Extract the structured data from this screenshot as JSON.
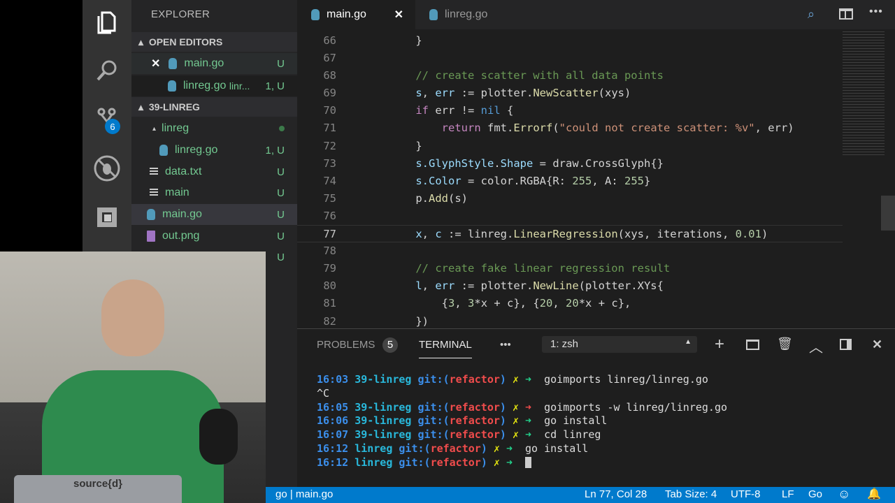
{
  "activity_bar": {
    "scm_badge": "6"
  },
  "sidebar": {
    "title": "EXPLORER",
    "open_editors": {
      "header": "OPEN EDITORS",
      "items": [
        {
          "name": "main.go",
          "status": "U"
        },
        {
          "name": "linreg.go",
          "desc": "linr...",
          "status": "1, U"
        }
      ]
    },
    "project": {
      "header": "39-LINREG",
      "items": [
        {
          "name": "linreg",
          "type": "folder"
        },
        {
          "name": "linreg.go",
          "status": "1, U"
        },
        {
          "name": "data.txt",
          "status": "U"
        },
        {
          "name": "main",
          "status": "U"
        },
        {
          "name": "main.go",
          "status": "U"
        },
        {
          "name": "out.png",
          "status": "U"
        },
        {
          "name": "",
          "status": "U"
        }
      ]
    }
  },
  "tabs": [
    {
      "label": "main.go",
      "active": true
    },
    {
      "label": "linreg.go",
      "active": false
    }
  ],
  "code": [
    {
      "n": "66",
      "t": [
        [
          "    }",
          "p"
        ]
      ]
    },
    {
      "n": "67",
      "t": []
    },
    {
      "n": "68",
      "t": [
        [
          "    // create scatter with all data points",
          "c"
        ]
      ]
    },
    {
      "n": "69",
      "t": [
        [
          "    s",
          "v"
        ],
        [
          ", ",
          "p"
        ],
        [
          "err",
          "v"
        ],
        [
          " := plotter.",
          "p"
        ],
        [
          "NewScatter",
          "f"
        ],
        [
          "(xys)",
          "p"
        ]
      ]
    },
    {
      "n": "70",
      "t": [
        [
          "    if",
          "k"
        ],
        [
          " err != ",
          "p"
        ],
        [
          "nil",
          "b"
        ],
        [
          " {",
          "p"
        ]
      ]
    },
    {
      "n": "71",
      "t": [
        [
          "        return",
          "k"
        ],
        [
          " fmt.",
          "p"
        ],
        [
          "Errorf",
          "f"
        ],
        [
          "(",
          "p"
        ],
        [
          "\"could not create scatter: %v\"",
          "s"
        ],
        [
          ", err)",
          "p"
        ]
      ]
    },
    {
      "n": "72",
      "t": [
        [
          "    }",
          "p"
        ]
      ]
    },
    {
      "n": "73",
      "t": [
        [
          "    s.",
          "v"
        ],
        [
          "GlyphStyle",
          "v"
        ],
        [
          ".",
          "p"
        ],
        [
          "Shape",
          "v"
        ],
        [
          " = draw.",
          "p"
        ],
        [
          "CrossGlyph",
          "p"
        ],
        [
          "{}",
          "p"
        ]
      ]
    },
    {
      "n": "74",
      "t": [
        [
          "    s.",
          "v"
        ],
        [
          "Color",
          "v"
        ],
        [
          " = color.",
          "p"
        ],
        [
          "RGBA",
          "p"
        ],
        [
          "{R: ",
          "p"
        ],
        [
          "255",
          "n"
        ],
        [
          ", A: ",
          "p"
        ],
        [
          "255",
          "n"
        ],
        [
          "}",
          "p"
        ]
      ]
    },
    {
      "n": "75",
      "t": [
        [
          "    p.",
          "p"
        ],
        [
          "Add",
          "f"
        ],
        [
          "(s)",
          "p"
        ]
      ]
    },
    {
      "n": "76",
      "t": []
    },
    {
      "n": "77",
      "t": [
        [
          "    x",
          "v"
        ],
        [
          ", ",
          "p"
        ],
        [
          "c",
          "v"
        ],
        [
          " := linreg.",
          "p"
        ],
        [
          "LinearRegression",
          "f"
        ],
        [
          "(xys, iterations, ",
          "p"
        ],
        [
          "0.01",
          "n"
        ],
        [
          ")",
          "p"
        ]
      ],
      "current": true
    },
    {
      "n": "78",
      "t": []
    },
    {
      "n": "79",
      "t": [
        [
          "    // create fake linear regression result",
          "c"
        ]
      ]
    },
    {
      "n": "80",
      "t": [
        [
          "    l",
          "v"
        ],
        [
          ", ",
          "p"
        ],
        [
          "err",
          "v"
        ],
        [
          " := plotter.",
          "p"
        ],
        [
          "NewLine",
          "f"
        ],
        [
          "(plotter.XYs{",
          "p"
        ]
      ]
    },
    {
      "n": "81",
      "t": [
        [
          "        {",
          "p"
        ],
        [
          "3",
          "n"
        ],
        [
          ", ",
          "p"
        ],
        [
          "3",
          "n"
        ],
        [
          "*x + c}, {",
          "p"
        ],
        [
          "20",
          "n"
        ],
        [
          ", ",
          "p"
        ],
        [
          "20",
          "n"
        ],
        [
          "*x + c},",
          "p"
        ]
      ]
    },
    {
      "n": "82",
      "t": [
        [
          "    })",
          "p"
        ]
      ]
    }
  ],
  "panel": {
    "problems_label": "PROBLEMS",
    "problems_count": "5",
    "terminal_label": "TERMINAL",
    "more": "•••",
    "shell_select": "1: zsh"
  },
  "terminal": [
    [
      [
        "16:03 ",
        "tm"
      ],
      [
        "39-linreg ",
        "dir"
      ],
      [
        "git:(",
        "gb"
      ],
      [
        "refactor",
        "gr"
      ],
      [
        ") ",
        "gb"
      ],
      [
        "✗ ",
        "y"
      ],
      [
        "➜ ",
        "g"
      ],
      [
        " goimports linreg/linreg.go",
        ""
      ]
    ],
    [
      [
        "^C",
        ""
      ]
    ],
    [
      [
        "16:05 ",
        "tm"
      ],
      [
        "39-linreg ",
        "dir"
      ],
      [
        "git:(",
        "gb"
      ],
      [
        "refactor",
        "gr"
      ],
      [
        ") ",
        "gb"
      ],
      [
        "✗ ",
        "y"
      ],
      [
        "➜ ",
        "r"
      ],
      [
        " goimports -w linreg/linreg.go",
        ""
      ]
    ],
    [
      [
        "16:06 ",
        "tm"
      ],
      [
        "39-linreg ",
        "dir"
      ],
      [
        "git:(",
        "gb"
      ],
      [
        "refactor",
        "gr"
      ],
      [
        ") ",
        "gb"
      ],
      [
        "✗ ",
        "y"
      ],
      [
        "➜ ",
        "g"
      ],
      [
        " go install",
        ""
      ]
    ],
    [
      [
        "16:07 ",
        "tm"
      ],
      [
        "39-linreg ",
        "dir"
      ],
      [
        "git:(",
        "gb"
      ],
      [
        "refactor",
        "gr"
      ],
      [
        ") ",
        "gb"
      ],
      [
        "✗ ",
        "y"
      ],
      [
        "➜ ",
        "g"
      ],
      [
        " cd linreg",
        ""
      ]
    ],
    [
      [
        "16:12 ",
        "tm"
      ],
      [
        "linreg ",
        "dir"
      ],
      [
        "git:(",
        "gb"
      ],
      [
        "refactor",
        "gr"
      ],
      [
        ") ",
        "gb"
      ],
      [
        "✗ ",
        "y"
      ],
      [
        "➜ ",
        "g"
      ],
      [
        " go install",
        ""
      ]
    ],
    [
      [
        "16:12 ",
        "tm"
      ],
      [
        "linreg ",
        "dir"
      ],
      [
        "git:(",
        "gb"
      ],
      [
        "refactor",
        "gr"
      ],
      [
        ") ",
        "gb"
      ],
      [
        "✗ ",
        "y"
      ],
      [
        "➜ ",
        "g"
      ],
      [
        " ",
        ""
      ]
    ]
  ],
  "status": {
    "left": "go | main.go",
    "position": "Ln 77, Col 28",
    "tab_size": "Tab Size: 4",
    "encoding": "UTF-8",
    "eol": "LF",
    "language": "Go"
  },
  "webcam": {
    "laptop_sticker": "source{d}"
  },
  "colors": {
    "status_bar": "#007acc",
    "badge": "#007acc",
    "file_untracked": "#73c991"
  }
}
